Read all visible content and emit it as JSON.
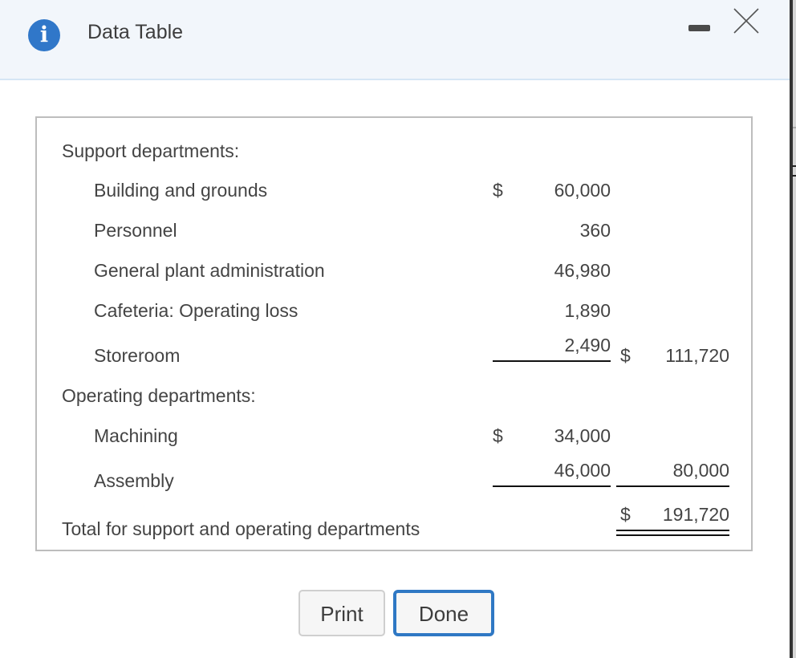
{
  "dialog": {
    "title": "Data Table",
    "icon": "info-icon",
    "window_controls": [
      "minimize-icon",
      "close-icon"
    ],
    "accent_color": "#3077c9"
  },
  "table": {
    "support_header": "Support departments:",
    "support_rows": [
      {
        "label": "Building and grounds",
        "dollar": "$",
        "amount": "60,000"
      },
      {
        "label": "Personnel",
        "dollar": "",
        "amount": "360"
      },
      {
        "label": "General plant administration",
        "dollar": "",
        "amount": "46,980"
      },
      {
        "label": "Cafeteria: Operating loss",
        "dollar": "",
        "amount": "1,890"
      },
      {
        "label": "Storeroom",
        "dollar": "",
        "amount": "2,490"
      }
    ],
    "support_total": {
      "dollar": "$",
      "amount": "111,720"
    },
    "operating_header": "Operating departments:",
    "operating_rows": [
      {
        "label": "Machining",
        "dollar": "$",
        "amount": "34,000"
      },
      {
        "label": "Assembly",
        "dollar": "",
        "amount": "46,000"
      }
    ],
    "operating_total": {
      "dollar": "",
      "amount": "80,000"
    },
    "grand_total": {
      "label": "Total for support and operating departments",
      "dollar": "$",
      "amount": "191,720"
    }
  },
  "buttons": {
    "print": "Print",
    "done": "Done"
  }
}
